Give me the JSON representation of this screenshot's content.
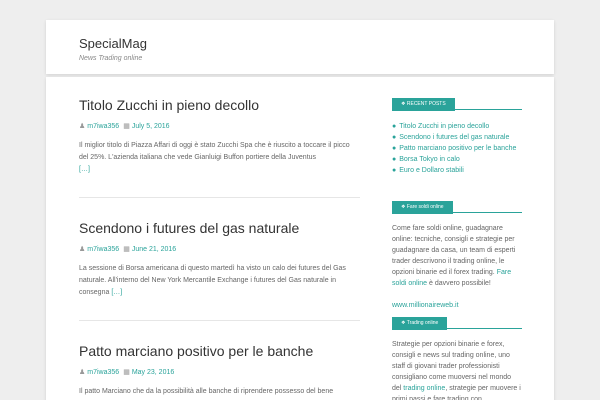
{
  "header": {
    "site_title": "SpecialMag",
    "site_description": "News Trading online"
  },
  "posts": [
    {
      "title": "Titolo Zucchi in pieno decollo",
      "author": "m7iwa356",
      "date": "July 5, 2016",
      "excerpt": "Il miglior titolo di Piazza Affari di oggi è stato Zucchi Spa che è riuscito a toccare il picco del 25%. L'azienda italiana che vede Gianluigi Buffon portiere della Juventus",
      "more": "[…]"
    },
    {
      "title": "Scendono i futures del gas naturale",
      "author": "m7iwa356",
      "date": "June 21, 2016",
      "excerpt": "La sessione di Borsa americana di questo martedì ha visto un calo dei futures del Gas naturale. All'interno del New York Mercantile Exchange i futures del Gas naturale in consegna",
      "more": "[…]"
    },
    {
      "title": "Patto marciano positivo per le banche",
      "author": "m7iwa356",
      "date": "May 23, 2016",
      "excerpt": "Il patto Marciano che da la possibilità alle banche di riprendere possesso del bene",
      "more": ""
    }
  ],
  "sidebar": {
    "recent_posts": {
      "title": "RECENT POSTS",
      "items": [
        "Titolo Zucchi in pieno decollo",
        "Scendono i futures del gas naturale",
        "Patto marciano positivo per le banche",
        "Borsa Tokyo in calo",
        "Euro e Dollaro stabili"
      ]
    },
    "fare_soldi": {
      "title": "Fare soldi online",
      "text_before": "Come fare soldi online, guadagnare online: tecniche, consigli e strategie per guadagnare da casa, un team di esperti trader descrivono il trading online, le opzioni binarie ed il forex trading.",
      "link": "Fare soldi online",
      "text_after": "è davvero possibile!",
      "site_link": "www.millionaireweb.it"
    },
    "trading_online": {
      "title": "Trading online",
      "text_before": "Strategie per opzioni binarie e forex, consigli e news sul trading online, uno staff di giovani trader professionisti consigliano come muoversi nel mondo del",
      "link": "trading online",
      "text_after": ", strategie per muovere i primi passi e fare trading con consapevolezza"
    }
  },
  "colors": {
    "accent": "#2aa39a",
    "background": "#eeeeee",
    "card": "#ffffff"
  },
  "icons": {
    "author": "user-icon",
    "date": "calendar-icon",
    "widget_title": "bullet-icon"
  }
}
